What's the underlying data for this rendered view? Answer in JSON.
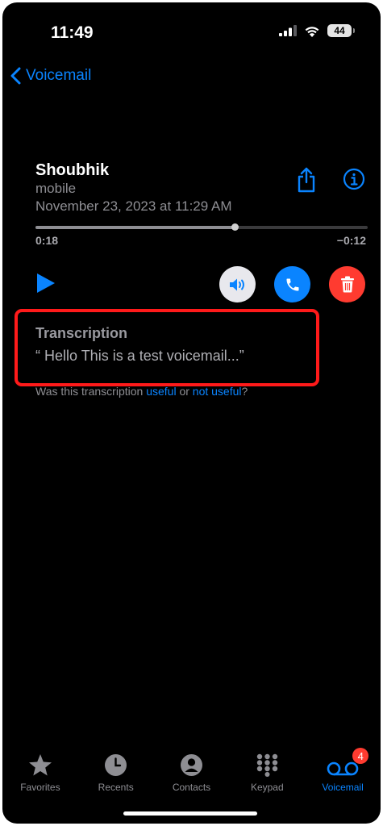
{
  "status_bar": {
    "time": "11:49",
    "battery": "44"
  },
  "nav": {
    "back_label": "Voicemail"
  },
  "voicemail": {
    "caller": "Shoubhik",
    "label": "mobile",
    "date": "November 23, 2023 at 11:29 AM",
    "elapsed": "0:18",
    "remaining": "−0:12",
    "progress_fraction": 0.6
  },
  "transcription": {
    "title": "Transcription",
    "text": "“ Hello This is a test voicemail...”",
    "feedback_prefix": "Was this transcription ",
    "useful": "useful",
    "or": " or ",
    "not_useful": "not useful",
    "suffix": "?"
  },
  "tabs": [
    {
      "label": "Favorites",
      "icon": "star-icon"
    },
    {
      "label": "Recents",
      "icon": "clock-icon"
    },
    {
      "label": "Contacts",
      "icon": "person-icon"
    },
    {
      "label": "Keypad",
      "icon": "keypad-icon"
    },
    {
      "label": "Voicemail",
      "icon": "voicemail-icon",
      "badge": "4",
      "active": true
    }
  ],
  "colors": {
    "accent": "#0a84ff",
    "delete": "#ff3b30",
    "highlight": "#ff1a1a"
  }
}
